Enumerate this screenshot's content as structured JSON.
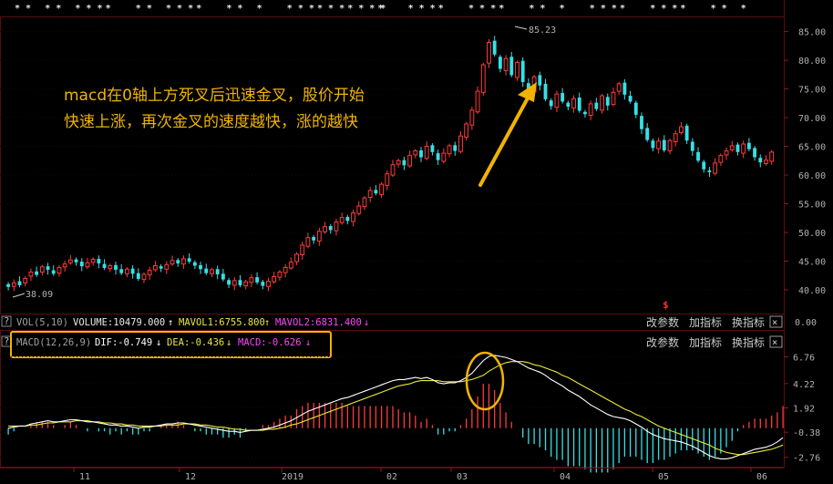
{
  "colors": {
    "up": "#ff3b3b",
    "down": "#36e0e6",
    "dif": "#ffffff",
    "dea": "#e8e83a",
    "accent": "#f0b400",
    "mavol2": "#ff44ff"
  },
  "top_markers": [
    "* *",
    "* *",
    "* * *",
    "*",
    "* *",
    "* * *",
    "*",
    "* *",
    "*",
    "* * *",
    "* * *",
    "* * * *",
    "*",
    "* * *",
    "*",
    "* * *",
    "*",
    "* *",
    "*",
    "* * *",
    "*",
    "* * *",
    "*",
    "* *",
    "*"
  ],
  "annotation": {
    "line1": "macd在0轴上方死叉后迅速金叉，股价开始",
    "line2": "快速上涨，再次金叉的速度越快，涨的越快"
  },
  "price_panel": {
    "y_ticks": [
      "85.00",
      "80.00",
      "75.00",
      "70.00",
      "65.00",
      "60.00",
      "55.00",
      "50.00",
      "45.00",
      "40.00"
    ],
    "high_label": "85.23",
    "low_label": "38.09",
    "dividend_marker": "$"
  },
  "vol_panel": {
    "name": "VOL(5,10)",
    "volume": "VOLUME:10479.000",
    "mavol1": "MAVOL1:6755.800",
    "mavol2": "MAVOL2:6831.400",
    "right_value": "0.00"
  },
  "macd_panel": {
    "name": "MACD(12,26,9)",
    "dif": "DIF:-0.749",
    "dea": "DEA:-0.436",
    "macd": "MACD:-0.626",
    "y_ticks": [
      "6.76",
      "4.22",
      "1.92",
      "-0.38",
      "-2.76"
    ]
  },
  "controls": {
    "params": "改参数",
    "add_indicator": "加指标",
    "switch_indicator": "换指标",
    "close": "×",
    "help": "?"
  },
  "x_ticks": [
    "11",
    "12",
    "2019",
    "02",
    "03",
    "04",
    "05",
    "06"
  ],
  "chart_data": [
    {
      "type": "candlestick",
      "yticks": [
        85,
        80,
        75,
        70,
        65,
        60,
        55,
        50,
        45,
        40
      ],
      "high_point": 85.23,
      "low_point": 38.09,
      "close": [
        40.5,
        41.2,
        40.8,
        42.0,
        43.1,
        42.6,
        44.0,
        43.5,
        42.8,
        43.9,
        44.5,
        45.2,
        44.8,
        44.1,
        44.7,
        45.3,
        44.6,
        43.8,
        44.2,
        43.5,
        42.9,
        43.6,
        42.8,
        41.9,
        42.7,
        43.4,
        44.2,
        43.7,
        44.4,
        45.1,
        44.6,
        45.4,
        44.9,
        44.2,
        43.6,
        42.9,
        43.5,
        42.7,
        41.8,
        40.9,
        41.6,
        40.8,
        41.4,
        42.1,
        41.3,
        40.7,
        41.5,
        42.3,
        43.1,
        43.9,
        44.8,
        46.2,
        47.8,
        49.1,
        48.6,
        50.2,
        51.0,
        50.4,
        51.8,
        52.6,
        52.0,
        53.4,
        54.6,
        56.0,
        57.3,
        56.8,
        58.4,
        60.2,
        61.8,
        62.5,
        61.7,
        63.4,
        64.2,
        63.1,
        65.0,
        64.0,
        62.6,
        63.8,
        65.1,
        64.2,
        66.8,
        68.9,
        71.3,
        74.6,
        79.2,
        83.1,
        81.0,
        78.5,
        80.3,
        77.4,
        79.6,
        76.2,
        74.8,
        77.1,
        75.6,
        73.2,
        72.0,
        74.1,
        72.8,
        71.9,
        73.3,
        71.2,
        70.6,
        72.4,
        71.5,
        73.8,
        72.1,
        74.4,
        75.9,
        74.0,
        72.8,
        70.5,
        68.0,
        66.1,
        64.7,
        65.9,
        64.3,
        66.0,
        67.2,
        68.4,
        66.0,
        64.2,
        62.5,
        61.0,
        60.5,
        62.1,
        63.4,
        64.2,
        65.1,
        64.0,
        65.4,
        64.5,
        63.1,
        62.2,
        62.6,
        64.0,
        66.4
      ],
      "open": [
        41.0,
        40.6,
        41.5,
        41.2,
        42.4,
        43.2,
        43.1,
        44.1,
        43.4,
        42.9,
        44.0,
        44.7,
        45.3,
        44.9,
        44.0,
        44.8,
        45.4,
        44.5,
        43.7,
        44.3,
        43.6,
        42.8,
        43.7,
        42.9,
        41.8,
        42.6,
        43.5,
        44.1,
        43.6,
        44.5,
        45.2,
        44.5,
        45.5,
        44.8,
        44.3,
        43.7,
        42.8,
        43.6,
        42.8,
        41.7,
        40.8,
        41.7,
        40.7,
        41.3,
        42.2,
        41.4,
        40.6,
        41.4,
        42.2,
        43.0,
        43.8,
        44.9,
        46.1,
        47.6,
        49.2,
        48.5,
        50.1,
        51.1,
        50.3,
        51.7,
        52.7,
        51.9,
        53.3,
        54.5,
        56.1,
        57.4,
        56.6,
        58.2,
        60.0,
        61.9,
        62.6,
        61.6,
        63.5,
        64.3,
        62.9,
        65.2,
        63.8,
        62.4,
        63.7,
        65.2,
        64.1,
        66.6,
        68.7,
        71.0,
        74.4,
        79.5,
        83.4,
        80.6,
        78.2,
        80.6,
        77.0,
        79.9,
        76.0,
        74.5,
        77.4,
        75.9,
        73.0,
        71.8,
        74.3,
        72.6,
        71.7,
        73.5,
        71.0,
        70.4,
        72.6,
        71.3,
        73.6,
        72.3,
        74.6,
        76.1,
        73.8,
        72.6,
        70.3,
        68.2,
        66.0,
        64.6,
        66.1,
        64.2,
        65.8,
        67.4,
        68.6,
        65.8,
        64.0,
        62.3,
        60.8,
        60.3,
        62.2,
        63.5,
        64.4,
        65.3,
        63.8,
        65.6,
        64.7,
        63.0,
        62.0,
        62.4
      ]
    },
    {
      "type": "line",
      "name": "MACD(12,26,9)",
      "yticks": [
        6.76,
        4.22,
        1.92,
        -0.38,
        -2.76
      ],
      "series": [
        {
          "name": "DIF",
          "values": [
            0.0,
            0.1,
            0.2,
            0.2,
            0.4,
            0.5,
            0.6,
            0.7,
            0.6,
            0.6,
            0.7,
            0.8,
            0.8,
            0.7,
            0.6,
            0.6,
            0.5,
            0.4,
            0.3,
            0.3,
            0.2,
            0.2,
            0.1,
            0.0,
            0.1,
            0.1,
            0.2,
            0.3,
            0.4,
            0.4,
            0.5,
            0.5,
            0.4,
            0.3,
            0.2,
            0.1,
            0.0,
            -0.1,
            -0.2,
            -0.3,
            -0.3,
            -0.4,
            -0.3,
            -0.2,
            -0.2,
            -0.1,
            0.0,
            0.1,
            0.3,
            0.5,
            0.7,
            1.0,
            1.3,
            1.6,
            1.8,
            2.0,
            2.2,
            2.4,
            2.6,
            2.8,
            2.9,
            3.1,
            3.3,
            3.5,
            3.7,
            3.9,
            4.1,
            4.3,
            4.5,
            4.6,
            4.6,
            4.7,
            4.8,
            4.7,
            4.8,
            4.6,
            4.3,
            4.2,
            4.3,
            4.3,
            4.5,
            4.8,
            5.2,
            5.8,
            6.4,
            6.8,
            6.9,
            6.8,
            6.7,
            6.5,
            6.3,
            6.0,
            5.7,
            5.5,
            5.3,
            5.0,
            4.6,
            4.3,
            4.0,
            3.6,
            3.3,
            3.0,
            2.6,
            2.2,
            1.9,
            1.6,
            1.3,
            1.1,
            1.0,
            0.9,
            0.7,
            0.4,
            0.1,
            -0.3,
            -0.6,
            -0.8,
            -1.0,
            -1.1,
            -1.2,
            -1.3,
            -1.5,
            -1.7,
            -2.0,
            -2.3,
            -2.6,
            -2.8,
            -2.9,
            -2.9,
            -2.8,
            -2.6,
            -2.4,
            -2.2,
            -2.0,
            -1.9,
            -1.8,
            -1.6,
            -1.3,
            -0.9
          ]
        },
        {
          "name": "DEA",
          "values": [
            0.2,
            0.2,
            0.2,
            0.2,
            0.3,
            0.3,
            0.4,
            0.5,
            0.5,
            0.6,
            0.6,
            0.6,
            0.7,
            0.7,
            0.7,
            0.6,
            0.6,
            0.5,
            0.5,
            0.4,
            0.4,
            0.3,
            0.3,
            0.2,
            0.2,
            0.2,
            0.2,
            0.2,
            0.3,
            0.3,
            0.3,
            0.4,
            0.4,
            0.4,
            0.3,
            0.3,
            0.2,
            0.1,
            0.1,
            0.0,
            -0.1,
            -0.1,
            -0.2,
            -0.2,
            -0.2,
            -0.2,
            -0.1,
            -0.1,
            0.0,
            0.1,
            0.3,
            0.4,
            0.6,
            0.8,
            1.0,
            1.2,
            1.4,
            1.6,
            1.8,
            2.0,
            2.2,
            2.4,
            2.6,
            2.8,
            3.0,
            3.2,
            3.4,
            3.6,
            3.8,
            4.0,
            4.1,
            4.2,
            4.4,
            4.5,
            4.5,
            4.5,
            4.5,
            4.4,
            4.4,
            4.4,
            4.4,
            4.5,
            4.6,
            4.8,
            5.0,
            5.4,
            5.7,
            6.0,
            6.2,
            6.3,
            6.3,
            6.3,
            6.2,
            6.0,
            5.9,
            5.7,
            5.5,
            5.3,
            5.0,
            4.8,
            4.5,
            4.2,
            3.9,
            3.6,
            3.3,
            3.0,
            2.7,
            2.4,
            2.1,
            1.8,
            1.6,
            1.3,
            1.1,
            0.8,
            0.5,
            0.2,
            0.0,
            -0.2,
            -0.4,
            -0.6,
            -0.8,
            -1.0,
            -1.2,
            -1.4,
            -1.6,
            -1.9,
            -2.1,
            -2.3,
            -2.4,
            -2.5,
            -2.5,
            -2.4,
            -2.3,
            -2.2,
            -2.1,
            -2.0,
            -1.8,
            -1.6
          ]
        },
        {
          "name": "MACD",
          "values": [
            -0.2,
            -0.1,
            0.0,
            0.0,
            0.1,
            0.2,
            0.2,
            0.2,
            0.1,
            0.0,
            0.1,
            0.2,
            0.1,
            0.0,
            -0.1,
            0.0,
            -0.1,
            -0.1,
            -0.2,
            -0.1,
            -0.2,
            -0.1,
            -0.2,
            -0.2,
            -0.1,
            -0.1,
            0.0,
            0.1,
            0.1,
            0.1,
            0.2,
            0.1,
            0.0,
            -0.1,
            -0.1,
            -0.2,
            -0.2,
            -0.2,
            -0.3,
            -0.3,
            -0.2,
            -0.3,
            -0.1,
            0.0,
            0.0,
            0.1,
            0.1,
            0.2,
            0.3,
            0.4,
            0.4,
            0.6,
            0.7,
            0.8,
            0.8,
            0.8,
            0.8,
            0.8,
            0.8,
            0.8,
            0.7,
            0.7,
            0.7,
            0.7,
            0.7,
            0.7,
            0.7,
            0.7,
            0.7,
            0.6,
            0.5,
            0.5,
            0.4,
            0.2,
            0.3,
            0.1,
            -0.2,
            -0.2,
            -0.1,
            -0.1,
            0.1,
            0.3,
            0.6,
            1.0,
            1.4,
            1.4,
            1.2,
            0.8,
            0.5,
            0.2,
            0.0,
            -0.3,
            -0.5,
            -0.5,
            -0.6,
            -0.7,
            -0.9,
            -1.0,
            -1.0,
            -1.2,
            -1.2,
            -1.2,
            -1.3,
            -1.4,
            -1.4,
            -1.4,
            -1.4,
            -1.3,
            -1.1,
            -0.9,
            -0.9,
            -0.9,
            -1.0,
            -1.1,
            -1.1,
            -1.0,
            -1.0,
            -0.9,
            -0.8,
            -0.7,
            -0.7,
            -0.7,
            -0.8,
            -0.9,
            -1.0,
            -0.9,
            -0.8,
            -0.6,
            -0.4,
            -0.1,
            0.1,
            0.2,
            0.3,
            0.3,
            0.3,
            0.4,
            0.5,
            0.7
          ]
        }
      ]
    }
  ]
}
